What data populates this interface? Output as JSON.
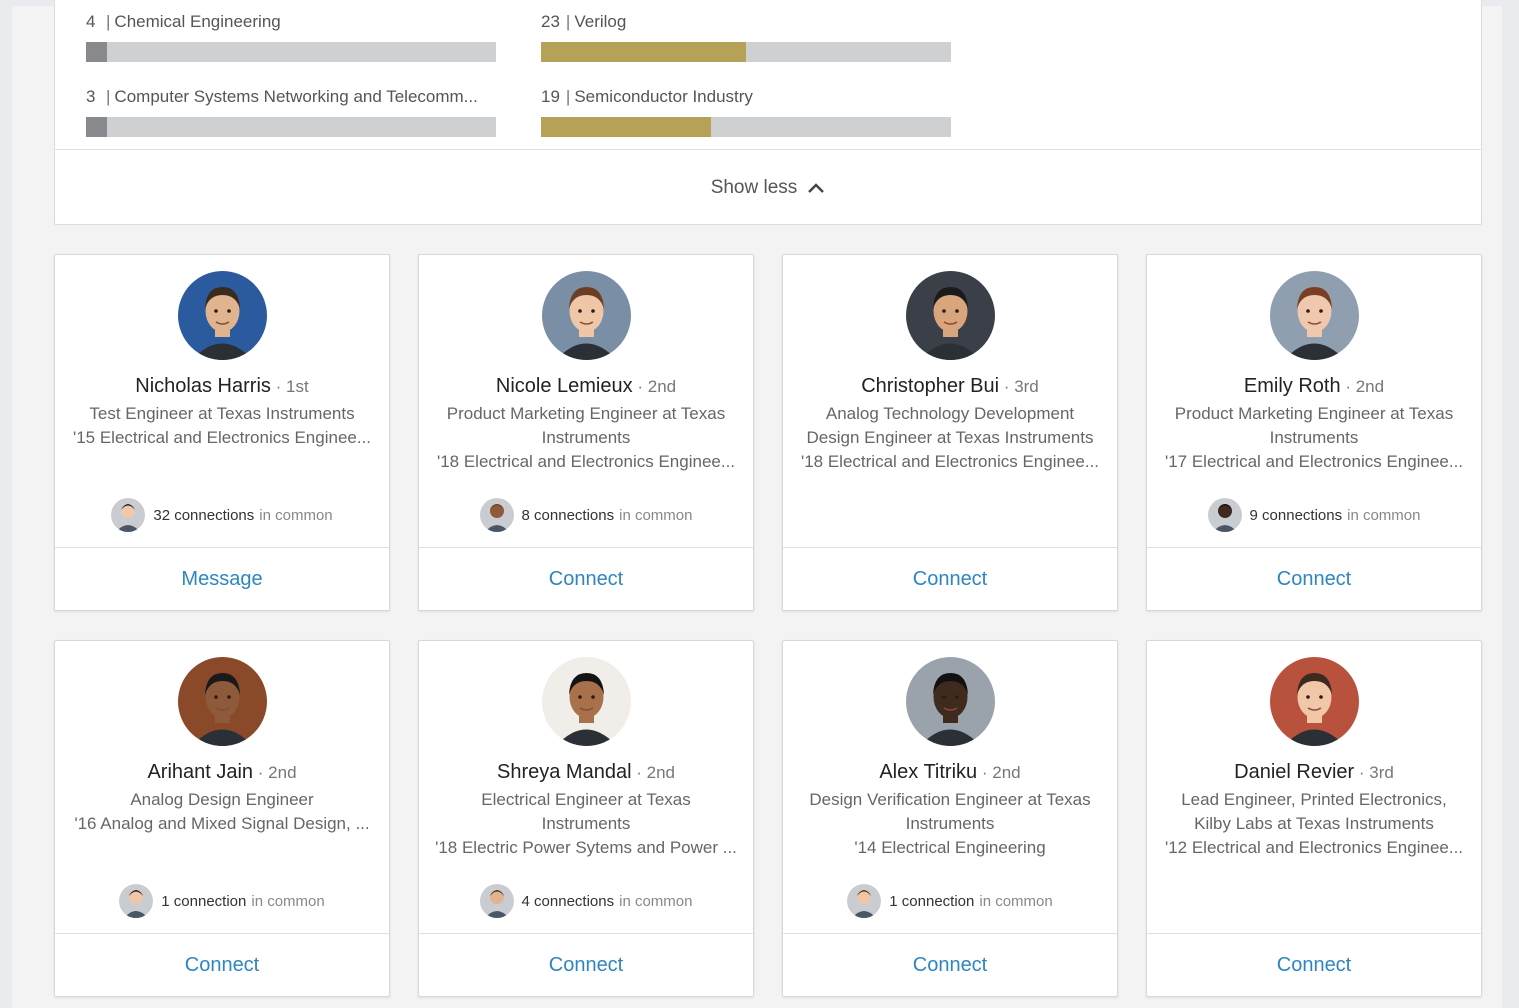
{
  "skills": [
    {
      "count": "4",
      "name": "Chemical Engineering",
      "fill": 0.05,
      "color": "#87898c"
    },
    {
      "count": "23",
      "name": "Verilog",
      "fill": 0.5,
      "color": "#b5a257"
    },
    {
      "count": "3",
      "name": "Computer Systems Networking and Telecomm...",
      "fill": 0.05,
      "color": "#87898c"
    },
    {
      "count": "19",
      "name": "Semiconductor Industry",
      "fill": 0.415,
      "color": "#b5a257"
    }
  ],
  "show_less_label": "Show less",
  "cards": [
    {
      "name": "Nicholas Harris",
      "degree": "1st",
      "lines": [
        "Test Engineer at Texas Instruments",
        "'15 Electrical and Electronics Enginee..."
      ],
      "mutual_count": "32 connections",
      "mutual_text": "in common",
      "action": "Message"
    },
    {
      "name": "Nicole Lemieux",
      "degree": "2nd",
      "lines": [
        "Product Marketing Engineer at Texas",
        "Instruments",
        "'18 Electrical and Electronics Enginee..."
      ],
      "mutual_count": "8 connections",
      "mutual_text": "in common",
      "action": "Connect"
    },
    {
      "name": "Christopher Bui",
      "degree": "3rd",
      "lines": [
        "Analog Technology Development",
        "Design Engineer at Texas Instruments",
        "'18 Electrical and Electronics Enginee..."
      ],
      "mutual_count": "",
      "mutual_text": "",
      "action": "Connect"
    },
    {
      "name": "Emily Roth",
      "degree": "2nd",
      "lines": [
        "Product Marketing Engineer at Texas",
        "Instruments",
        "'17 Electrical and Electronics Enginee..."
      ],
      "mutual_count": "9 connections",
      "mutual_text": "in common",
      "action": "Connect"
    },
    {
      "name": "Arihant Jain",
      "degree": "2nd",
      "lines": [
        "Analog Design Engineer",
        "'16 Analog and Mixed Signal Design, ..."
      ],
      "mutual_count": "1 connection",
      "mutual_text": "in common",
      "action": "Connect"
    },
    {
      "name": "Shreya Mandal",
      "degree": "2nd",
      "lines": [
        "Electrical Engineer at Texas",
        "Instruments",
        "'18 Electric Power Sytems and Power ..."
      ],
      "mutual_count": "4 connections",
      "mutual_text": "in common",
      "action": "Connect"
    },
    {
      "name": "Alex Titriku",
      "degree": "2nd",
      "lines": [
        "Design Verification Engineer at Texas",
        "Instruments",
        "'14 Electrical Engineering"
      ],
      "mutual_count": "1 connection",
      "mutual_text": "in common",
      "action": "Connect"
    },
    {
      "name": "Daniel Revier",
      "degree": "3rd",
      "lines": [
        "Lead Engineer, Printed Electronics,",
        "Kilby Labs at Texas Instruments",
        "'12 Electrical and Electronics Enginee..."
      ],
      "mutual_count": "",
      "mutual_text": "",
      "action": "Connect"
    }
  ],
  "avatar_colors": [
    "#2b5a9e",
    "#7a8fa6",
    "#3a3f48",
    "#8f9fb0",
    "#8a4a2a",
    "#f1eee9",
    "#9aa3ab",
    "#b9523c"
  ],
  "skin_tones": [
    "#e0b48e",
    "#efc7a6",
    "#d8a57c",
    "#f0c8ae",
    "#8d5a3b",
    "#a9714b",
    "#3f2a1e",
    "#f2c7a8"
  ],
  "hair_colors": [
    "#3b2a1e",
    "#6b3f24",
    "#1b1b1b",
    "#7a3e22",
    "#1a1a1a",
    "#141414",
    "#111111",
    "#3a2a20"
  ]
}
